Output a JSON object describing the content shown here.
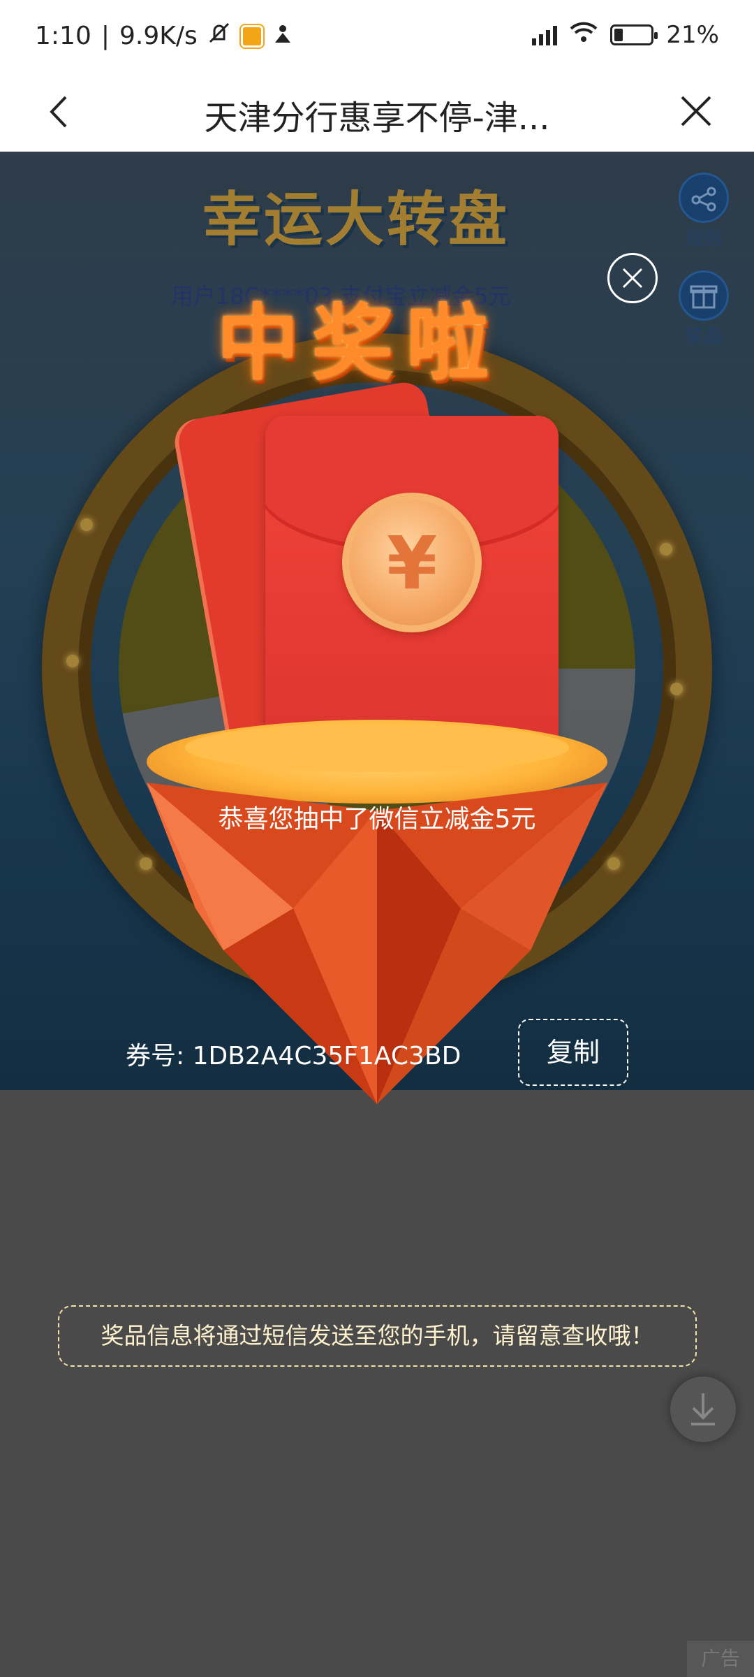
{
  "status_bar": {
    "time": "1:10",
    "speed": "9.9K/s",
    "battery": "21%",
    "icons": [
      "mute-icon",
      "app-notification-icon",
      "person-icon",
      "signal-icon",
      "wifi-icon",
      "battery-icon"
    ]
  },
  "nav": {
    "title": "天津分行惠享不停-津...",
    "back_icon": "chevron-left-icon",
    "close_icon": "close-icon"
  },
  "background_page": {
    "game_title": "幸运大转盘",
    "rules_label": "规则",
    "prizes_label": "奖品",
    "marquee": "用户18C****03  支付宝立减金5元"
  },
  "prize_modal": {
    "headline": "中奖啦",
    "coin_symbol": "¥",
    "congrats_text": "恭喜您抽中了微信立减金5元",
    "coupon_label": "券号:",
    "coupon_code": "1DB2A4C35F1AC3BD",
    "copy_label": "复制",
    "close_icon": "close-circle-icon"
  },
  "notice": {
    "sms_text": "奖品信息将通过短信发送至您的手机，请留意查收哦！"
  },
  "ad": {
    "label": "广告",
    "download_icon": "download-icon"
  },
  "colors": {
    "overlay": "#4a4a4a",
    "headline": "#ff8a2a",
    "envelope_red": "#e63b33",
    "coin": "#f5a763",
    "notice_border": "#f4e2a6"
  }
}
